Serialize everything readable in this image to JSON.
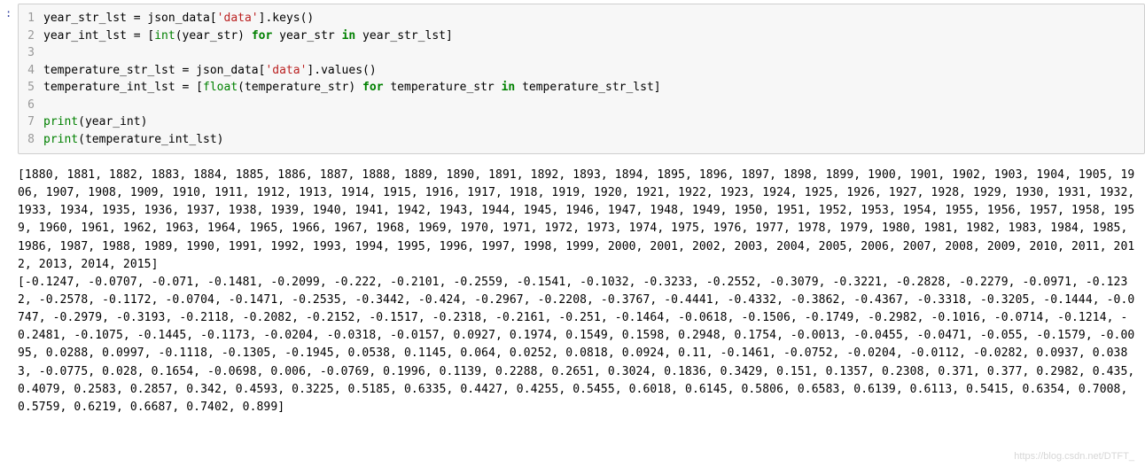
{
  "code": {
    "lines": [
      "year_str_lst = json_data['data'].keys()",
      "year_int_lst = [int(year_str) for year_str in year_str_lst]",
      "",
      "temperature_str_lst = json_data['data'].values()",
      "temperature_int_lst = [float(temperature_str) for temperature_str in temperature_str_lst]",
      "",
      "print(year_int)",
      "print(temperature_int_lst)"
    ],
    "nums": [
      "1",
      "2",
      "3",
      "4",
      "5",
      "6",
      "7",
      "8"
    ]
  },
  "years": [
    1880,
    1881,
    1882,
    1883,
    1884,
    1885,
    1886,
    1887,
    1888,
    1889,
    1890,
    1891,
    1892,
    1893,
    1894,
    1895,
    1896,
    1897,
    1898,
    1899,
    1900,
    1901,
    1902,
    1903,
    1904,
    1905,
    1906,
    1907,
    1908,
    1909,
    1910,
    1911,
    1912,
    1913,
    1914,
    1915,
    1916,
    1917,
    1918,
    1919,
    1920,
    1921,
    1922,
    1923,
    1924,
    1925,
    1926,
    1927,
    1928,
    1929,
    1930,
    1931,
    1932,
    1933,
    1934,
    1935,
    1936,
    1937,
    1938,
    1939,
    1940,
    1941,
    1942,
    1943,
    1944,
    1945,
    1946,
    1947,
    1948,
    1949,
    1950,
    1951,
    1952,
    1953,
    1954,
    1955,
    1956,
    1957,
    1958,
    1959,
    1960,
    1961,
    1962,
    1963,
    1964,
    1965,
    1966,
    1967,
    1968,
    1969,
    1970,
    1971,
    1972,
    1973,
    1974,
    1975,
    1976,
    1977,
    1978,
    1979,
    1980,
    1981,
    1982,
    1983,
    1984,
    1985,
    1986,
    1987,
    1988,
    1989,
    1990,
    1991,
    1992,
    1993,
    1994,
    1995,
    1996,
    1997,
    1998,
    1999,
    2000,
    2001,
    2002,
    2003,
    2004,
    2005,
    2006,
    2007,
    2008,
    2009,
    2010,
    2011,
    2012,
    2013,
    2014,
    2015
  ],
  "temps": [
    -0.1247,
    -0.0707,
    -0.071,
    -0.1481,
    -0.2099,
    -0.222,
    -0.2101,
    -0.2559,
    -0.1541,
    -0.1032,
    -0.3233,
    -0.2552,
    -0.3079,
    -0.3221,
    -0.2828,
    -0.2279,
    -0.0971,
    -0.1232,
    -0.2578,
    -0.1172,
    -0.0704,
    -0.1471,
    -0.2535,
    -0.3442,
    -0.424,
    -0.2967,
    -0.2208,
    -0.3767,
    -0.4441,
    -0.4332,
    -0.3862,
    -0.4367,
    -0.3318,
    -0.3205,
    -0.1444,
    -0.0747,
    -0.2979,
    -0.3193,
    -0.2118,
    -0.2082,
    -0.2152,
    -0.1517,
    -0.2318,
    -0.2161,
    -0.251,
    -0.1464,
    -0.0618,
    -0.1506,
    -0.1749,
    -0.2982,
    -0.1016,
    -0.0714,
    -0.1214,
    -0.2481,
    -0.1075,
    -0.1445,
    -0.1173,
    -0.0204,
    -0.0318,
    -0.0157,
    0.0927,
    0.1974,
    0.1549,
    0.1598,
    0.2948,
    0.1754,
    -0.0013,
    -0.0455,
    -0.0471,
    -0.055,
    -0.1579,
    -0.0095,
    0.0288,
    0.0997,
    -0.1118,
    -0.1305,
    -0.1945,
    0.0538,
    0.1145,
    0.064,
    0.0252,
    0.0818,
    0.0924,
    0.11,
    -0.1461,
    -0.0752,
    -0.0204,
    -0.0112,
    -0.0282,
    0.0937,
    0.0383,
    -0.0775,
    0.028,
    0.1654,
    -0.0698,
    0.006,
    -0.0769,
    0.1996,
    0.1139,
    0.2288,
    0.2651,
    0.3024,
    0.1836,
    0.3429,
    0.151,
    0.1357,
    0.2308,
    0.371,
    0.377,
    0.2982,
    0.435,
    0.4079,
    0.2583,
    0.2857,
    0.342,
    0.4593,
    0.3225,
    0.5185,
    0.6335,
    0.4427,
    0.4255,
    0.5455,
    0.6018,
    0.6145,
    0.5806,
    0.6583,
    0.6139,
    0.6113,
    0.5415,
    0.6354,
    0.7008,
    0.5759,
    0.6219,
    0.6687,
    0.7402,
    0.899
  ],
  "watermark": "https://blog.csdn.net/DTFT_"
}
